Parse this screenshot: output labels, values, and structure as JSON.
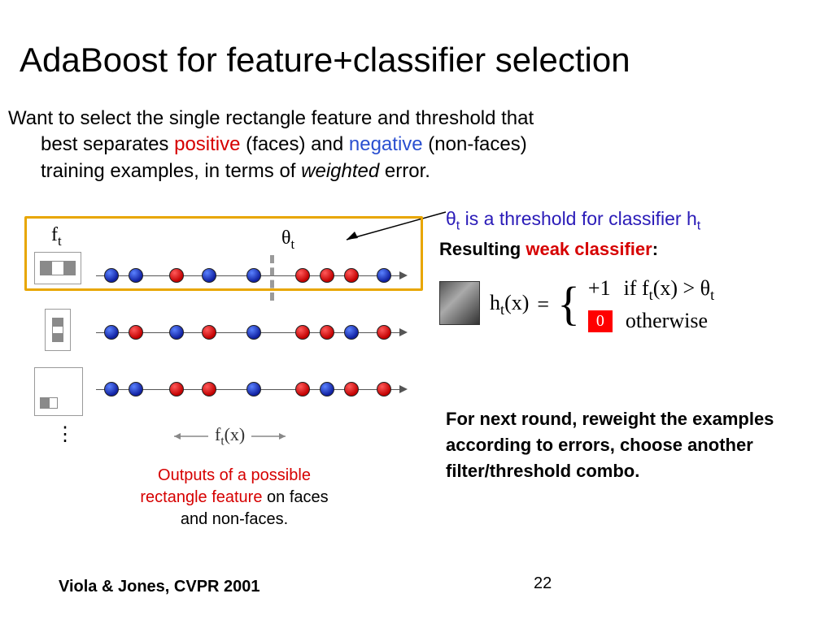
{
  "title": "AdaBoost for feature+classifier selection",
  "intro": {
    "line1a": "Want to select the single rectangle feature and threshold that",
    "line2a": "best separates ",
    "positive": "positive",
    "line2b": " (faces) and ",
    "negative": "negative",
    "line2c": " (non-faces)",
    "line3a": "training examples, in terms of ",
    "weighted": "weighted",
    "line3b": " error."
  },
  "diagram": {
    "ft_label": "f",
    "ft_sub": "t",
    "theta_label": "θ",
    "theta_sub": "t",
    "row1_colors": [
      "b",
      "b",
      "r",
      "b",
      "b",
      "r",
      "r",
      "r",
      "b"
    ],
    "row2_colors": [
      "b",
      "r",
      "b",
      "r",
      "b",
      "r",
      "r",
      "b",
      "r"
    ],
    "row3_colors": [
      "b",
      "b",
      "r",
      "r",
      "b",
      "r",
      "b",
      "r",
      "r"
    ],
    "vdots": "⋮",
    "ftx": "f",
    "ftx_sub": "t",
    "ftx_tail": "(x)",
    "caption_a": "Outputs of a possible rectangle feature",
    "caption_b": " on faces and non-faces."
  },
  "right": {
    "threshold_note_a": "θ",
    "threshold_note_sub1": "t",
    "threshold_note_b": " is a threshold for classifier h",
    "threshold_note_sub2": "t",
    "weak_label_a": "Resulting ",
    "weak_label_b": "weak classifier",
    "weak_label_c": ":",
    "formula": {
      "lhs_a": "h",
      "lhs_sub": "t",
      "lhs_b": "(x)",
      "eq": "=",
      "plus1": "+1",
      "if": "if  f",
      "if_sub": "t",
      "if_tail": "(x) > θ",
      "if_sub2": "t",
      "zero": "0",
      "otherwise": "otherwise"
    },
    "next_round": "For next round, reweight the examples according to errors, choose another filter/threshold combo."
  },
  "citation": "Viola & Jones, CVPR 2001",
  "pagenum": "22"
}
